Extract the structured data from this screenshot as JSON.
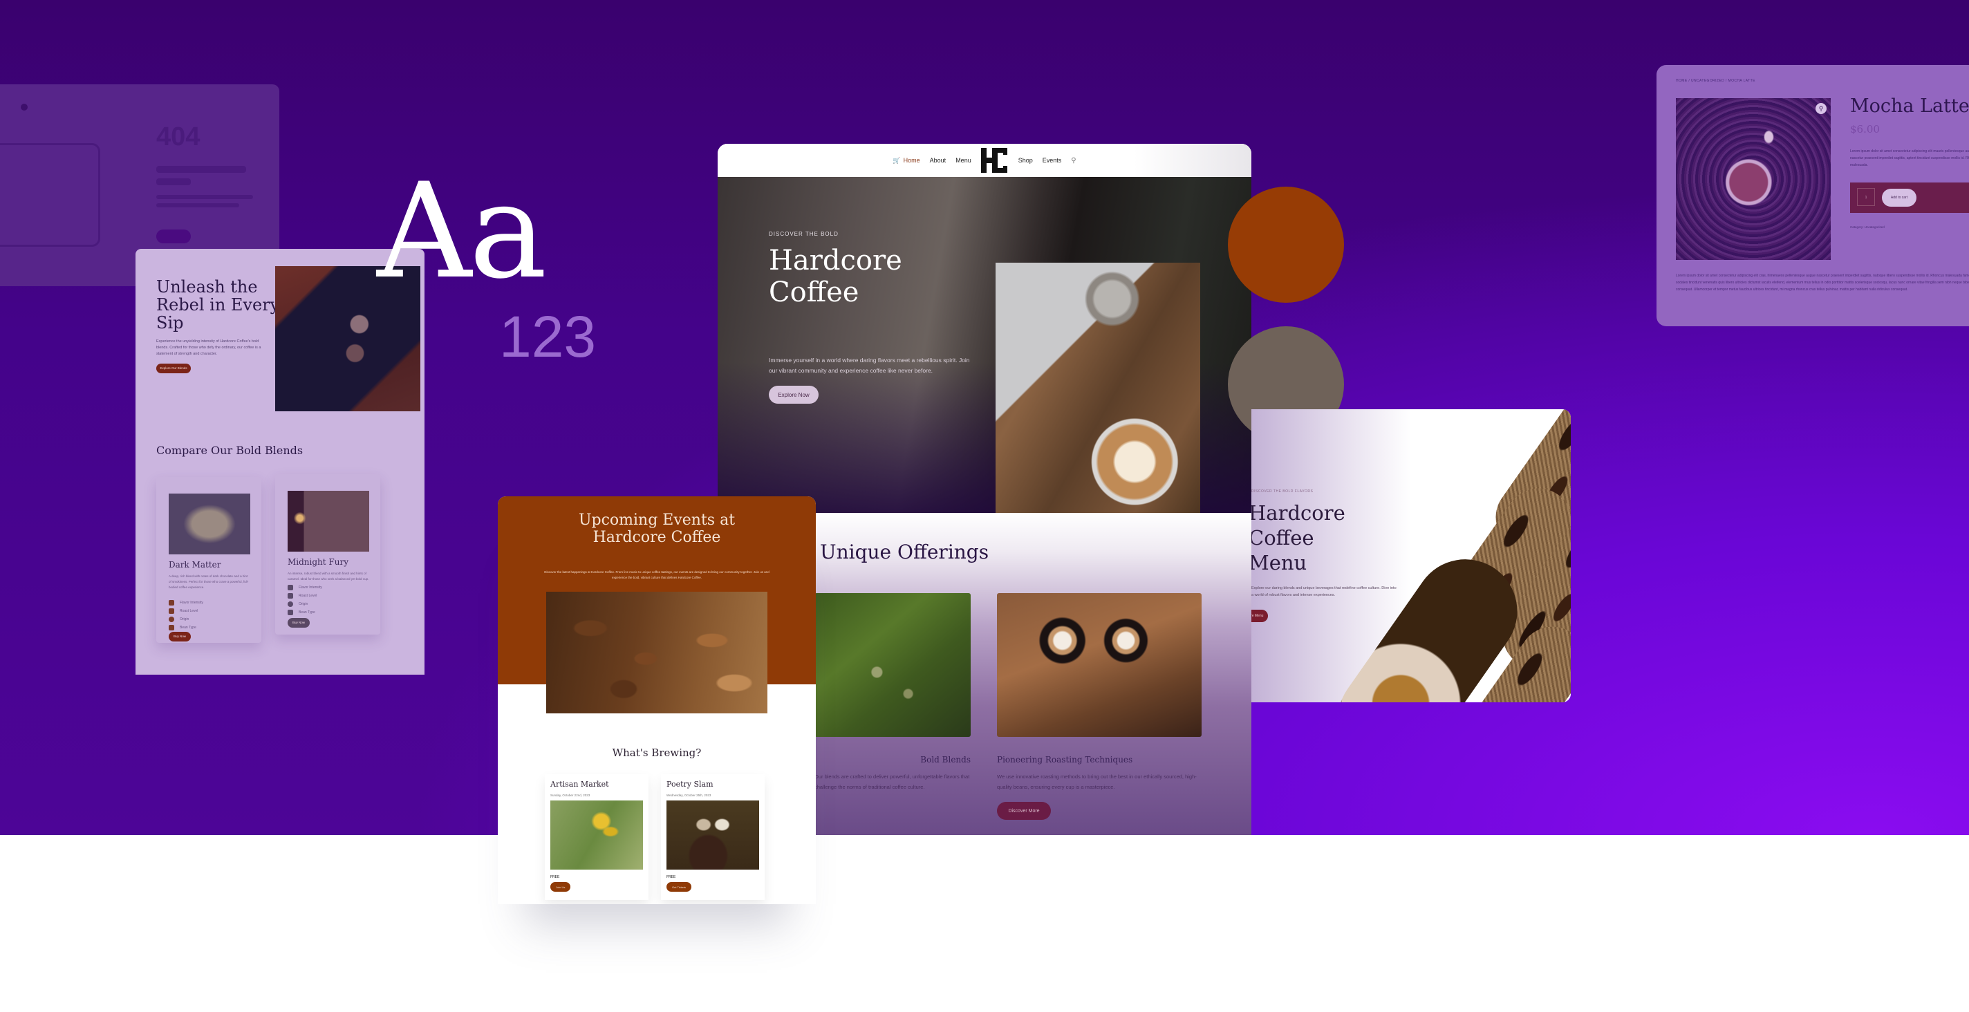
{
  "colors": {
    "background_purple": "#44038a",
    "accent_orange": "#8f3a06",
    "accent_taupe": "#6f6259",
    "brand_dark": "#2b1947"
  },
  "typography_sample": {
    "glyphs": "Aa",
    "numerals": "123"
  },
  "swatches": [
    {
      "name": "burnt-orange",
      "color": "#973c05"
    },
    {
      "name": "taupe",
      "color": "#6f6259"
    }
  ],
  "error_page": {
    "code": "404"
  },
  "home_page": {
    "nav": {
      "items": [
        "Home",
        "About",
        "Menu",
        "Shop",
        "Events"
      ],
      "active": "Home",
      "logo": "HC"
    },
    "hero": {
      "kicker": "DISCOVER THE BOLD",
      "title_line1": "Hardcore",
      "title_line2": "Coffee",
      "subtitle": "Immerse yourself in a world where daring flavors meet a rebellious spirit. Join our vibrant community and experience coffee like never before.",
      "button": "Explore Now"
    },
    "offerings": {
      "title": "Unique Offerings",
      "items": [
        {
          "heading": "Bold Blends",
          "text": "Our blends are crafted to deliver powerful, unforgettable flavors that challenge the norms of traditional coffee culture."
        },
        {
          "heading": "Pioneering Roasting Techniques",
          "text": "We use innovative roasting methods to bring out the best in our ethically sourced, high-quality beans, ensuring every cup is a masterpiece."
        }
      ],
      "button": "Discover More"
    }
  },
  "about_page": {
    "title": "Unleash the Rebel in Every Sip",
    "text": "Experience the unyielding intensity of Hardcore Coffee's bold blends. Crafted for those who defy the ordinary, our coffee is a statement of strength and character.",
    "button": "Explore Our Blends",
    "compare_title": "Compare Our Bold Blends",
    "blends": [
      {
        "name": "Dark Matter",
        "text": "A deep, rich blend with notes of dark chocolate and a hint of smokiness. Perfect for those who crave a powerful, full-bodied coffee experience.",
        "features": [
          "Flavor Intensity",
          "Roast Level",
          "Origin",
          "Bean Type"
        ],
        "button": "Buy Now"
      },
      {
        "name": "Midnight Fury",
        "text": "An intense, robust blend with a smooth finish and hints of caramel. Ideal for those who seek a balanced yet bold cup.",
        "features": [
          "Flavor Intensity",
          "Roast Level",
          "Origin",
          "Bean Type"
        ],
        "button": "Buy Now"
      }
    ]
  },
  "events_page": {
    "title": "Upcoming Events at Hardcore Coffee",
    "description": "Discover the latest happenings at Hardcore Coffee. From live music to unique coffee tastings, our events are designed to bring our community together. Join us and experience the bold, vibrant culture that defines Hardcore Coffee.",
    "section_title": "What's Brewing?",
    "events": [
      {
        "title": "Artisan Market",
        "date": "Sunday, October 22nd, 2023",
        "price": "FREE",
        "button": "Join Us"
      },
      {
        "title": "Poetry Slam",
        "date": "Wednesday, October 25th, 2023",
        "price": "FREE",
        "button": "Get Tickets"
      }
    ]
  },
  "menu_page": {
    "kicker": "DISCOVER THE BOLD FLAVORS",
    "title_line1": "Hardcore",
    "title_line2": "Coffee",
    "title_line3": "Menu",
    "text": "Explore our daring blends and unique beverages that redefine coffee culture. Dive into a world of robust flavors and intense experiences.",
    "button": "Explore Menu"
  },
  "product_page": {
    "breadcrumb": "HOME / UNCATEGORIZED / MOCHA LATTE",
    "title": "Mocha Latte",
    "price": "$6.00",
    "short_description": "Lorem ipsum dolor sit amet consectetur adipiscing elit mauris pellentesque augue nascetur praesent imperdiet sagittis, aptent tincidunt suspendisse mollis id. Rhoncus malesuada.",
    "quantity": "1",
    "add_to_cart": "Add to cart",
    "category": "Category: Uncategorized",
    "long_description": "Lorem ipsum dolor sit amet consectetur adipiscing elit cras, himenaeos pellentesque augue nascetur praesent imperdiet sagittis, natoque libero suspendisse mollis id. Rhoncus malesuada fames sodales tincidunt venenatis quis libero ultricies dictumst iaculis eleifend, elementum mus tellus in odio porttitor mattis scelerisque sociosqu, lacus nunc ornare vitae fringilla sem nibh neque bibendum consequat. Ullamcorper et tempor metus faucibus ultrices tincidunt, mi magna rhoncus cras tellus pulvinar, mattis per habitant nulla ridiculus consequat."
  }
}
